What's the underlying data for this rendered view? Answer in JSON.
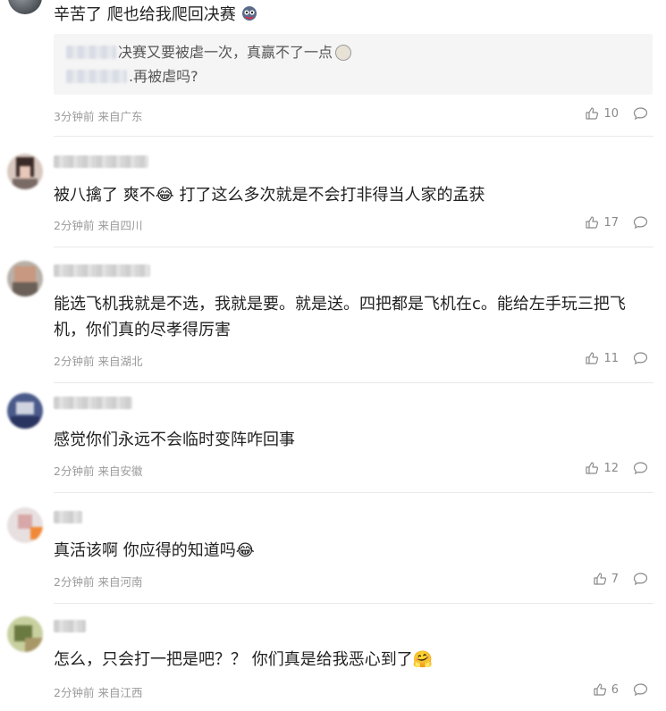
{
  "top_comment": {
    "text": "辛苦了 爬也给我爬回决赛",
    "quote_line1": "决赛又要被虐一次，真赢不了一点",
    "quote_line2": ".再被虐吗?",
    "meta_time": "3分钟前",
    "meta_location": "来自广东",
    "likes": "10",
    "emoji_icon": "ghost-emoji"
  },
  "comments": [
    {
      "text": "被八擒了 爽不😂 打了这么多次就是不会打非得当人家的孟获",
      "time": "2分钟前",
      "location": "来自四川",
      "likes": "17"
    },
    {
      "text": "能选飞机我就是不选，我就是要。就是送。四把都是飞机在c。能给左手玩三把飞机，你们真的尽孝得厉害",
      "time": "2分钟前",
      "location": "来自湖北",
      "likes": "11"
    },
    {
      "text": "感觉你们永远不会临时变阵咋回事",
      "time": "2分钟前",
      "location": "来自安徽",
      "likes": "12"
    },
    {
      "text": "真活该啊 你应得的知道吗😂",
      "time": "2分钟前",
      "location": "来自河南",
      "likes": "7"
    },
    {
      "text": "怎么，只会打一把是吧？？ 你们真是给我恶心到了🤗",
      "time": "2分钟前",
      "location": "来自江西",
      "likes": "6"
    }
  ],
  "colors": {
    "text": "#222222",
    "meta": "#9a9a9a",
    "quote_bg": "#f5f5f5",
    "divider": "#e9e9e9"
  }
}
